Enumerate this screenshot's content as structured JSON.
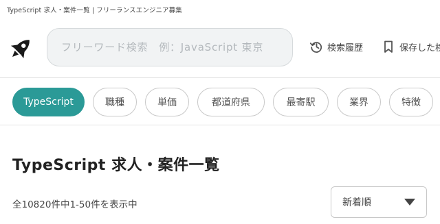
{
  "header": {
    "tagline": "TypeScript 求人・案件一覧 | フリーランスエンジニア募集",
    "logo_icon": "rocket-logo-icon",
    "search": {
      "placeholder": "フリーワード検索　例：JavaScript 東京",
      "value": ""
    },
    "history": {
      "label": "検索履歴",
      "icon": "history-icon"
    },
    "saved": {
      "label": "保存した検",
      "icon": "bookmark-icon"
    }
  },
  "filters": {
    "chips": [
      {
        "label": "TypeScript",
        "active": true
      },
      {
        "label": "職種",
        "active": false
      },
      {
        "label": "単価",
        "active": false
      },
      {
        "label": "都道府県",
        "active": false
      },
      {
        "label": "最寄駅",
        "active": false
      },
      {
        "label": "業界",
        "active": false
      },
      {
        "label": "特徴",
        "active": false
      }
    ],
    "active_color": "#2b9a97"
  },
  "main": {
    "title": "TypeScript 求人・案件一覧",
    "result_count": "全10820件中1-50件を表示中",
    "sort": {
      "selected": "新着順",
      "icon": "chevron-down-icon"
    }
  }
}
